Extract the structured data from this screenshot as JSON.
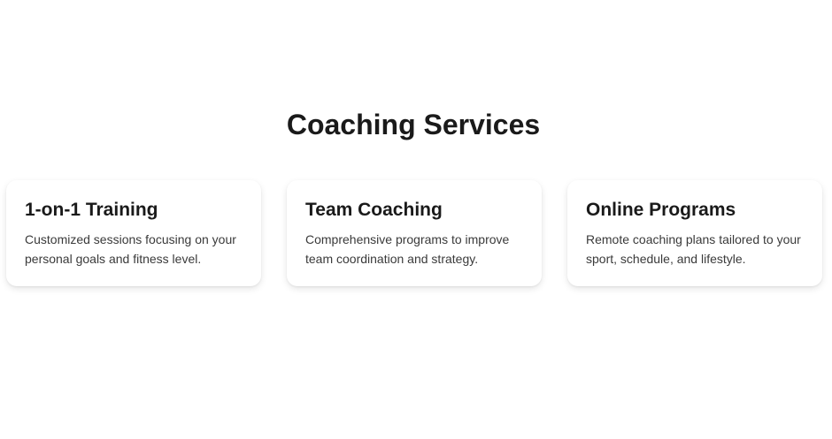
{
  "section": {
    "title": "Coaching Services"
  },
  "services": [
    {
      "title": "1-on-1 Training",
      "description": "Customized sessions focusing on your personal goals and fitness level."
    },
    {
      "title": "Team Coaching",
      "description": "Comprehensive programs to improve team coordination and strategy."
    },
    {
      "title": "Online Programs",
      "description": "Remote coaching plans tailored to your sport, schedule, and lifestyle."
    }
  ]
}
